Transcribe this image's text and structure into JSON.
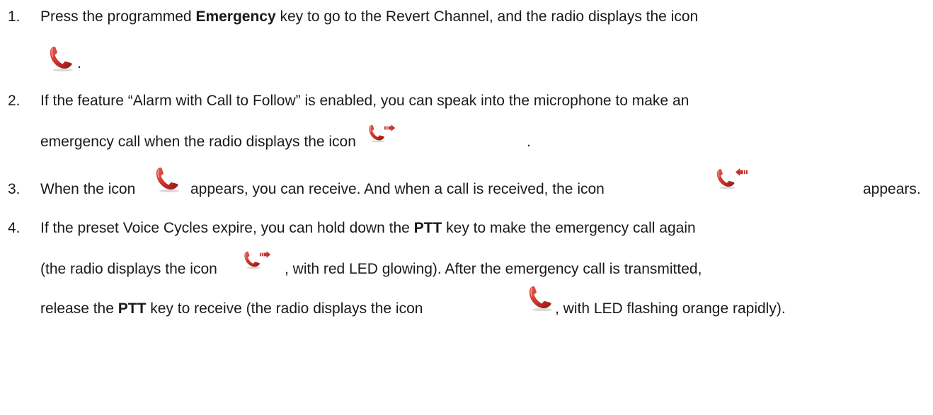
{
  "page": {
    "steps": [
      {
        "number": "1.",
        "line1": {
          "a": "Press the programmed ",
          "b": "Emergency",
          "c": " key to go to the Revert Channel, and the radio displays the icon"
        },
        "icon": "emergency-phone-icon",
        "end": "."
      },
      {
        "number": "2.",
        "line1": "If the feature “Alarm with Call to Follow” is enabled, you can speak into the microphone to make an",
        "line2": "emergency call when the radio displays the icon",
        "icon": "emergency-call-outgoing-icon",
        "end": "."
      },
      {
        "number": "3.",
        "a": "When the icon",
        "icon1": "emergency-phone-icon",
        "b": "appears, you can receive. And when a call is received, the icon",
        "icon2": "emergency-call-incoming-icon",
        "c": "appears."
      },
      {
        "number": "4.",
        "line1": {
          "a": "If the preset Voice Cycles expire, you can hold down the ",
          "b": "PTT",
          "c": " key to make the emergency call again"
        },
        "line2": {
          "a": "(the radio displays the icon",
          "icon": "emergency-call-outgoing-icon",
          "b": ", with red LED glowing). After the emergency call is transmitted,"
        },
        "line3": {
          "a": "release the ",
          "b": "PTT",
          "c": " key to receive (the radio displays the icon",
          "icon": "emergency-phone-icon",
          "d": ", with LED flashing orange rapidly)."
        }
      }
    ],
    "colors": {
      "text": "#1a1a1a",
      "icon_red": "#c8312a",
      "icon_dark": "#8a1812"
    }
  }
}
